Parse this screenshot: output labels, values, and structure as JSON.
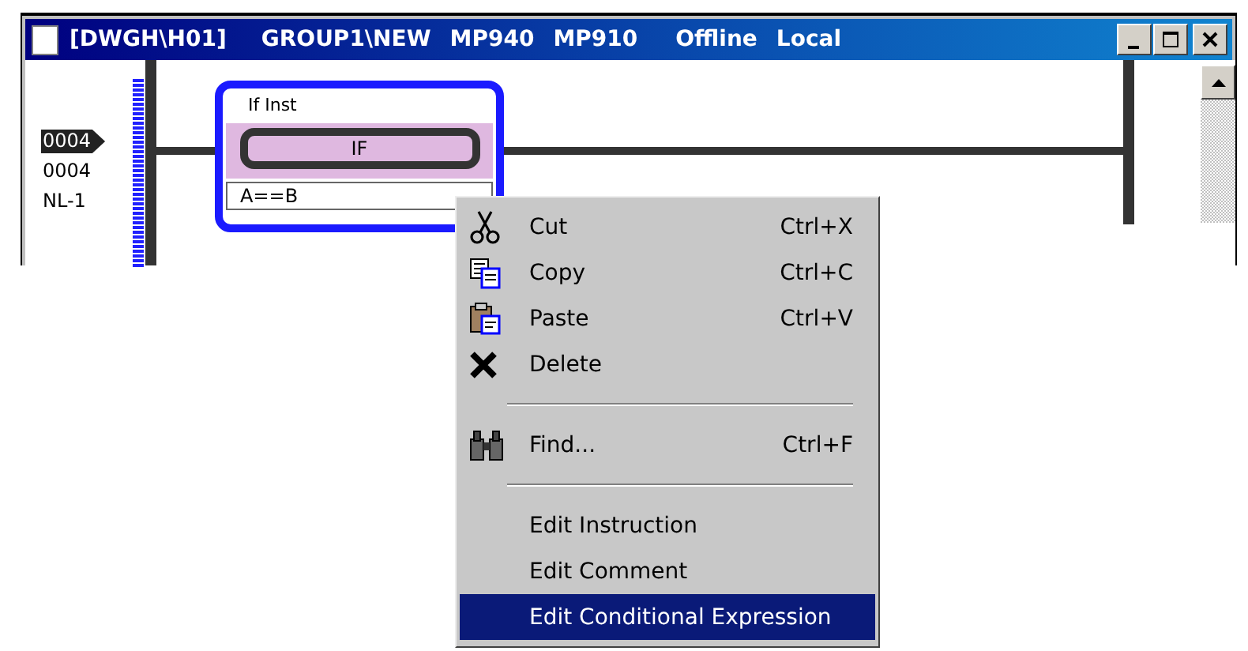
{
  "window": {
    "title_parts": [
      "[DWGH\\H01]",
      "GROUP1\\NEW",
      "MP940",
      "MP910",
      "Offline",
      "Local"
    ]
  },
  "ladder": {
    "step_labels": [
      {
        "text": "0004",
        "selected": true
      },
      {
        "text": "0004",
        "selected": false
      },
      {
        "text": "NL-1",
        "selected": false
      }
    ],
    "instruction": {
      "title": "If Inst",
      "name": "IF",
      "expression": "A==B",
      "selected": true
    }
  },
  "context_menu": {
    "items": [
      {
        "kind": "cut",
        "label": "Cut",
        "shortcut": "Ctrl+X",
        "selected": false
      },
      {
        "kind": "copy",
        "label": "Copy",
        "shortcut": "Ctrl+C",
        "selected": false
      },
      {
        "kind": "paste",
        "label": "Paste",
        "shortcut": "Ctrl+V",
        "selected": false
      },
      {
        "kind": "delete",
        "label": "Delete",
        "selected": false
      },
      {
        "kind": "separator"
      },
      {
        "kind": "find",
        "label": "Find...",
        "shortcut": "Ctrl+F",
        "selected": false
      },
      {
        "kind": "separator"
      },
      {
        "kind": "plain",
        "label": "Edit Instruction",
        "selected": false
      },
      {
        "kind": "plain",
        "label": "Edit Comment",
        "selected": false
      },
      {
        "kind": "plain",
        "label": "Edit Conditional Expression",
        "selected": true
      }
    ]
  }
}
